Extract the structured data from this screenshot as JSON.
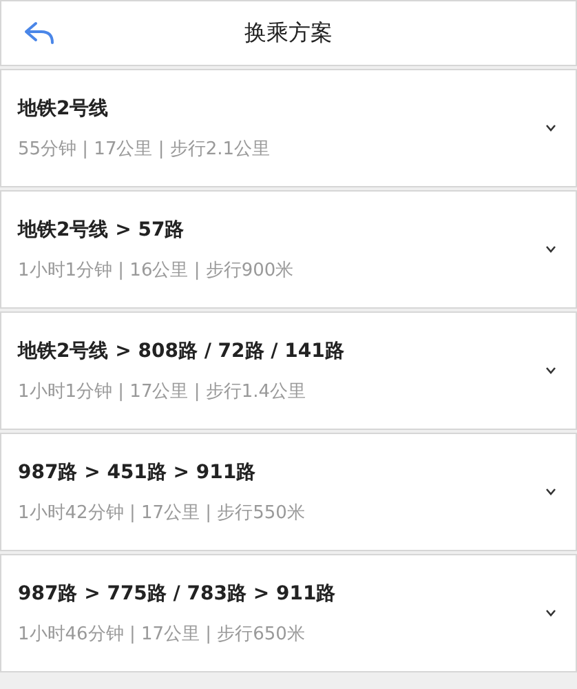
{
  "header": {
    "title": "换乘方案"
  },
  "routes": [
    {
      "title": "地铁2号线",
      "summary": "55分钟 | 17公里 | 步行2.1公里"
    },
    {
      "title": "地铁2号线 > 57路",
      "summary": "1小时1分钟 | 16公里 | 步行900米"
    },
    {
      "title": "地铁2号线 > 808路 / 72路 / 141路",
      "summary": "1小时1分钟 | 17公里 | 步行1.4公里"
    },
    {
      "title": "987路 > 451路 > 911路",
      "summary": "1小时42分钟 | 17公里 | 步行550米"
    },
    {
      "title": "987路 > 775路 / 783路 > 911路",
      "summary": "1小时46分钟 | 17公里 | 步行650米"
    }
  ]
}
